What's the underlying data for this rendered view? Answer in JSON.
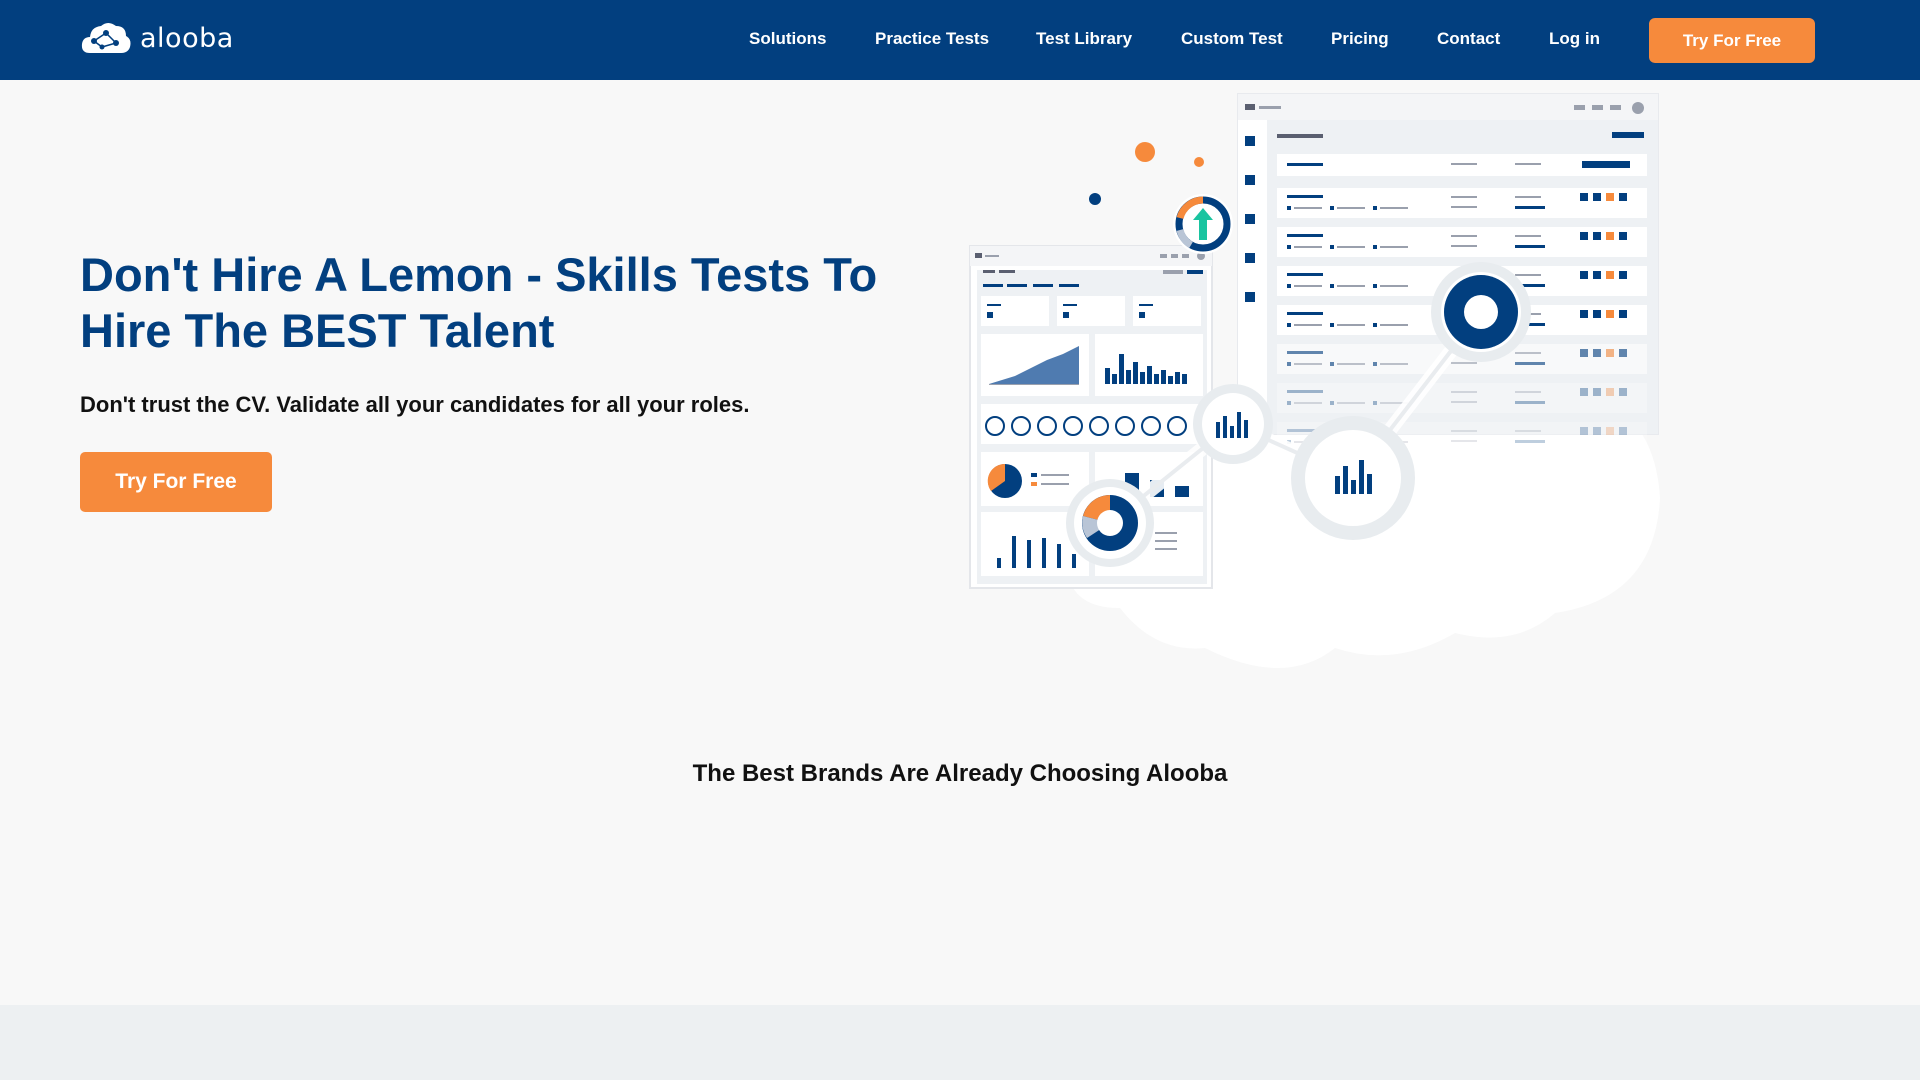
{
  "header": {
    "logo_text": "alooba",
    "nav": [
      {
        "label": "Solutions"
      },
      {
        "label": "Practice Tests"
      },
      {
        "label": "Test Library"
      },
      {
        "label": "Custom Test"
      },
      {
        "label": "Pricing"
      },
      {
        "label": "Contact"
      },
      {
        "label": "Log in"
      }
    ],
    "cta_label": "Try For Free"
  },
  "hero": {
    "title": "Don't Hire A Lemon - Skills Tests To Hire The BEST Talent",
    "subtitle": "Don't trust the CV. Validate all your candidates for all your roles.",
    "cta_label": "Try For Free"
  },
  "brands": {
    "heading": "The Best Brands Are Already Choosing Alooba"
  },
  "colors": {
    "brand_navy": "#023f7f",
    "accent_orange": "#f68a3c",
    "page_bg": "#f8f8f8",
    "band_bg": "#edf0f2"
  },
  "icons": {
    "logo": "cloud-network-logo-icon",
    "illustration": "dashboard-illustration"
  }
}
